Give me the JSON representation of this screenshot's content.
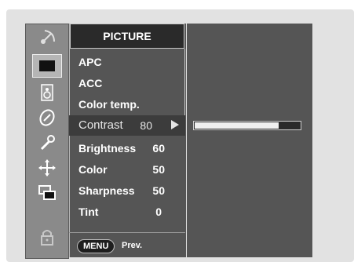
{
  "menu": {
    "title": "PICTURE",
    "items": [
      {
        "label": "APC",
        "value": ""
      },
      {
        "label": "ACC",
        "value": ""
      },
      {
        "label": "Color temp.",
        "value": ""
      },
      {
        "label": "Contrast",
        "value": "80"
      },
      {
        "label": "Brightness",
        "value": "60"
      },
      {
        "label": "Color",
        "value": "50"
      },
      {
        "label": "Sharpness",
        "value": "50"
      },
      {
        "label": "Tint",
        "value": "0"
      }
    ],
    "selected_index": 3
  },
  "footer": {
    "menu_button": "MENU",
    "prev_label": "Prev."
  },
  "slider": {
    "value_fraction": 0.8
  },
  "icons": [
    "satellite-dish-icon",
    "picture-icon",
    "speaker-icon",
    "clock-icon",
    "wrench-icon",
    "pip-move-icon",
    "windows-icon",
    "lock-icon"
  ],
  "colors": {
    "menu_bg": "#555555",
    "title_bg": "#2a2a2a",
    "active_bg": "#3c3c3c",
    "iconbar_bg": "#8a8a8a"
  }
}
